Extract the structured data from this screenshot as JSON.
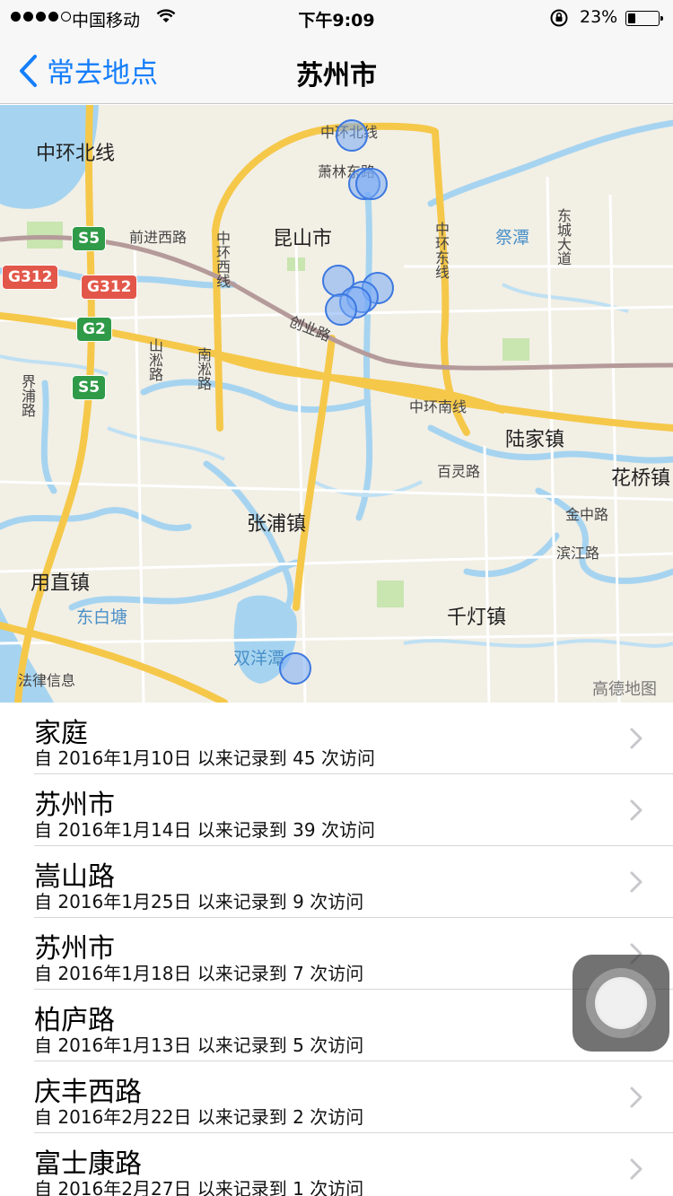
{
  "status": {
    "carrier": "中国移动",
    "time": "下午9:09",
    "battery_percent": "23%",
    "battery_level": 0.23
  },
  "nav": {
    "back_label": "常去地点",
    "title": "苏州市"
  },
  "map": {
    "labels": {
      "zhonghuan_bei": "中环北线",
      "xiaolin_dong": "萧林东路",
      "kunshan": "昆山市",
      "qianjin_xi": "前进西路",
      "zhonghuan_xi": "中环西线",
      "zhonghuan_dong": "中环东线",
      "jitan": "祭潭",
      "dongcheng": "东城大道",
      "chuangye": "创业路",
      "shanzhong": "山淞路",
      "nanfeng": "南淞路",
      "jiepu": "界浦路",
      "zhonghuan_nan": "中环南线",
      "lujia": "陆家镇",
      "bailing": "百灵路",
      "huaqiao": "花桥镇",
      "zhangpu": "张浦镇",
      "jinzhong": "金中路",
      "binjiang": "滨江路",
      "yongzhi": "用直镇",
      "dongbaitang": "东白塘",
      "qiandeng": "千灯镇",
      "shuangyangtan": "双洋潭",
      "legal": "法律信息",
      "attribution": "高德地图"
    },
    "shields": {
      "s5_top": "S5",
      "g312_left": "G312",
      "g312_mid": "G312",
      "g2": "G2",
      "s5_bottom": "S5"
    }
  },
  "places": [
    {
      "name": "家庭",
      "detail": "自 2016年1月10日 以来记录到 45 次访问"
    },
    {
      "name": "苏州市",
      "detail": "自 2016年1月14日 以来记录到 39 次访问"
    },
    {
      "name": "嵩山路",
      "detail": "自 2016年1月25日 以来记录到 9 次访问"
    },
    {
      "name": "苏州市",
      "detail": "自 2016年1月18日 以来记录到 7 次访问"
    },
    {
      "name": "柏庐路",
      "detail": "自 2016年1月13日 以来记录到 5 次访问"
    },
    {
      "name": "庆丰西路",
      "detail": "自 2016年2月22日 以来记录到 2 次访问"
    },
    {
      "name": "富士康路",
      "detail": "自 2016年2月27日 以来记录到 1 次访问"
    }
  ],
  "icons": {
    "back": "chevron-left-icon",
    "disclosure": "chevron-right-icon",
    "pin": "visit-marker-icon",
    "assistive": "assistive-touch-icon"
  },
  "colors": {
    "accent": "#157efb",
    "water": "#a6d4f0",
    "road_major": "#f5c84a",
    "pin_fill": "#78aaf5"
  }
}
